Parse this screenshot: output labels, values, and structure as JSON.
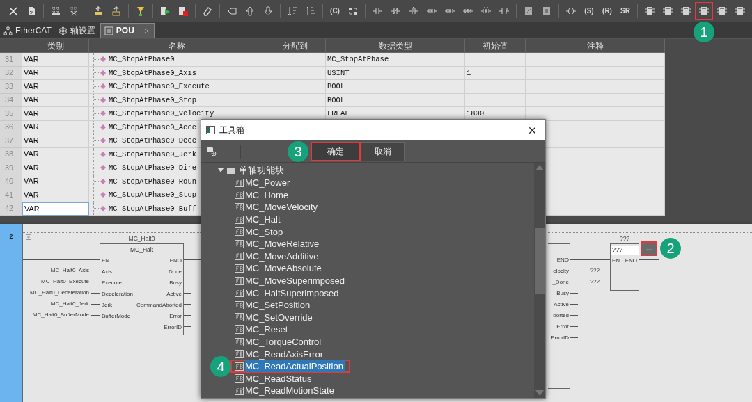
{
  "toolbar": {
    "groups": [
      [
        {
          "kind": "close",
          "highlighted": false
        },
        {
          "kind": "doc",
          "highlighted": false
        }
      ],
      [
        {
          "kind": "grid",
          "highlighted": false
        },
        {
          "kind": "grid-cross",
          "highlighted": false
        }
      ],
      [
        {
          "kind": "upload",
          "highlighted": false
        },
        {
          "kind": "upload-outline",
          "highlighted": false
        }
      ],
      [
        {
          "kind": "filter",
          "highlighted": false
        }
      ],
      [
        {
          "kind": "run",
          "highlighted": false
        },
        {
          "kind": "stop",
          "highlighted": false
        }
      ],
      [
        {
          "kind": "eraser",
          "highlighted": false
        }
      ],
      [
        {
          "kind": "back",
          "highlighted": false
        },
        {
          "kind": "up",
          "highlighted": false
        },
        {
          "kind": "down",
          "highlighted": false
        }
      ],
      [
        {
          "kind": "sort",
          "highlighted": false
        },
        {
          "kind": "sort-alt",
          "highlighted": false
        }
      ],
      [
        {
          "kind": "text",
          "label": "(C)",
          "highlighted": false
        },
        {
          "kind": "swap",
          "highlighted": false
        }
      ],
      [
        {
          "kind": "contact",
          "highlighted": false
        },
        {
          "kind": "contact-nc",
          "highlighted": false
        },
        {
          "kind": "contact-p",
          "highlighted": false
        },
        {
          "kind": "contact-dbl",
          "highlighted": false
        },
        {
          "kind": "contact-dbl",
          "highlighted": false
        },
        {
          "kind": "contact-dbl-nc",
          "highlighted": false
        },
        {
          "kind": "contact-dbl-p",
          "highlighted": false
        },
        {
          "kind": "contact-end",
          "highlighted": false
        }
      ],
      [
        {
          "kind": "box",
          "highlighted": false
        },
        {
          "kind": "box-alt",
          "highlighted": false
        }
      ],
      [
        {
          "kind": "coil",
          "highlighted": false
        },
        {
          "kind": "text",
          "label": "(S)",
          "highlighted": false
        },
        {
          "kind": "text",
          "label": "(R)",
          "highlighted": false
        },
        {
          "kind": "text",
          "label": "SR",
          "highlighted": false
        }
      ],
      [
        {
          "kind": "block",
          "highlighted": false
        },
        {
          "kind": "block",
          "highlighted": false
        },
        {
          "kind": "block",
          "highlighted": false
        },
        {
          "kind": "block",
          "highlighted": true,
          "callout": "1"
        },
        {
          "kind": "block",
          "highlighted": false
        },
        {
          "kind": "block",
          "highlighted": false
        }
      ]
    ]
  },
  "tabs": [
    {
      "label": "EtherCAT",
      "selected": false,
      "closable": false
    },
    {
      "label": "轴设置",
      "selected": false,
      "closable": false
    },
    {
      "label": "POU",
      "selected": true,
      "closable": true
    }
  ],
  "variable_table": {
    "columns": [
      "类别",
      "名称",
      "分配到",
      "数据类型",
      "初始值",
      "注释"
    ],
    "rows": [
      {
        "number": "31",
        "category": "VAR",
        "name": "MC_StopAtPhase0",
        "data_type": "MC_StopAtPhase",
        "selected": false
      },
      {
        "number": "32",
        "category": "VAR",
        "name": "MC_StopAtPhase0_Axis",
        "data_type": "USINT",
        "initial_value": "1",
        "selected": false
      },
      {
        "number": "33",
        "category": "VAR",
        "name": "MC_StopAtPhase0_Execute",
        "data_type": "BOOL",
        "selected": false
      },
      {
        "number": "34",
        "category": "VAR",
        "name": "MC_StopAtPhase0_Stop",
        "data_type": "BOOL",
        "selected": false
      },
      {
        "number": "35",
        "category": "VAR",
        "name": "MC_StopAtPhase0_Velocity",
        "data_type": "LREAL",
        "initial_value": "1800",
        "selected": false
      },
      {
        "number": "36",
        "category": "VAR",
        "name": "MC_StopAtPhase0_Acce",
        "selected": false
      },
      {
        "number": "37",
        "category": "VAR",
        "name": "MC_StopAtPhase0_Dece",
        "selected": false
      },
      {
        "number": "38",
        "category": "VAR",
        "name": "MC_StopAtPhase0_Jerk",
        "selected": false
      },
      {
        "number": "39",
        "category": "VAR",
        "name": "MC_StopAtPhase0_Dire",
        "selected": false
      },
      {
        "number": "40",
        "category": "VAR",
        "name": "MC_StopAtPhase0_Roun",
        "selected": false
      },
      {
        "number": "41",
        "category": "VAR",
        "name": "MC_StopAtPhase0_Stop",
        "selected": false
      },
      {
        "number": "42",
        "category": "VAR",
        "name": "MC_StopAtPhase0_Buff",
        "selected": true
      }
    ]
  },
  "ladder": {
    "rung_number": "2",
    "halt_block": {
      "instance": "MC_Halt0",
      "type": "MC_Halt",
      "inputs": [
        {
          "pin": "EN"
        },
        {
          "pin": "Axis",
          "variable": "MC_Halt0_Axis"
        },
        {
          "pin": "Execute",
          "variable": "MC_Halt0_Execute"
        },
        {
          "pin": "Deceleration",
          "variable": "MC_Halt0_Deceleration"
        },
        {
          "pin": "Jerk",
          "variable": "MC_Halt0_Jerk"
        },
        {
          "pin": "BufferMode",
          "variable": "MC_Halt0_BufferMode"
        }
      ],
      "outputs": [
        "ENO",
        "Done",
        "Busy",
        "Active",
        "CommandAborted",
        "Error",
        "ErrorID"
      ]
    },
    "partial_block": {
      "outputs": [
        "ENO",
        "elocity",
        "_Done",
        "Busy",
        "Active",
        "borted",
        "Error",
        "ErrorID"
      ]
    },
    "new_block": {
      "instance": "???",
      "type_field": "???",
      "inputs": [
        {
          "pin": "EN"
        },
        {
          "variable": "???"
        },
        {
          "variable": "???"
        }
      ],
      "outputs": [
        "ENO"
      ],
      "browse_button": {
        "label": "...",
        "highlighted": true,
        "callout": "2"
      }
    }
  },
  "dialog": {
    "title": "工具箱",
    "buttons": [
      {
        "label": "确定",
        "highlighted": true,
        "callout": "3"
      },
      {
        "label": "取消",
        "highlighted": false
      }
    ],
    "tree": {
      "label": "单轴功能块",
      "expanded": true,
      "children": [
        {
          "label": "MC_Power",
          "selected": false,
          "highlighted": false
        },
        {
          "label": "MC_Home",
          "selected": false,
          "highlighted": false
        },
        {
          "label": "MC_MoveVelocity",
          "selected": false,
          "highlighted": false
        },
        {
          "label": "MC_Halt",
          "selected": false,
          "highlighted": false
        },
        {
          "label": "MC_Stop",
          "selected": false,
          "highlighted": false
        },
        {
          "label": "MC_MoveRelative",
          "selected": false,
          "highlighted": false
        },
        {
          "label": "MC_MoveAdditive",
          "selected": false,
          "highlighted": false
        },
        {
          "label": "MC_MoveAbsolute",
          "selected": false,
          "highlighted": false
        },
        {
          "label": "MC_MoveSuperimposed",
          "selected": false,
          "highlighted": false
        },
        {
          "label": "MC_HaltSuperimposed",
          "selected": false,
          "highlighted": false
        },
        {
          "label": "MC_SetPosition",
          "selected": false,
          "highlighted": false
        },
        {
          "label": "MC_SetOverride",
          "selected": false,
          "highlighted": false
        },
        {
          "label": "MC_Reset",
          "selected": false,
          "highlighted": false
        },
        {
          "label": "MC_TorqueControl",
          "selected": false,
          "highlighted": false
        },
        {
          "label": "MC_ReadAxisError",
          "selected": false,
          "highlighted": false
        },
        {
          "label": "MC_ReadActualPosition",
          "selected": true,
          "highlighted": true,
          "callout": "4"
        },
        {
          "label": "MC_ReadStatus",
          "selected": false,
          "highlighted": false
        },
        {
          "label": "MC_ReadMotionState",
          "selected": false,
          "highlighted": false
        }
      ]
    }
  }
}
